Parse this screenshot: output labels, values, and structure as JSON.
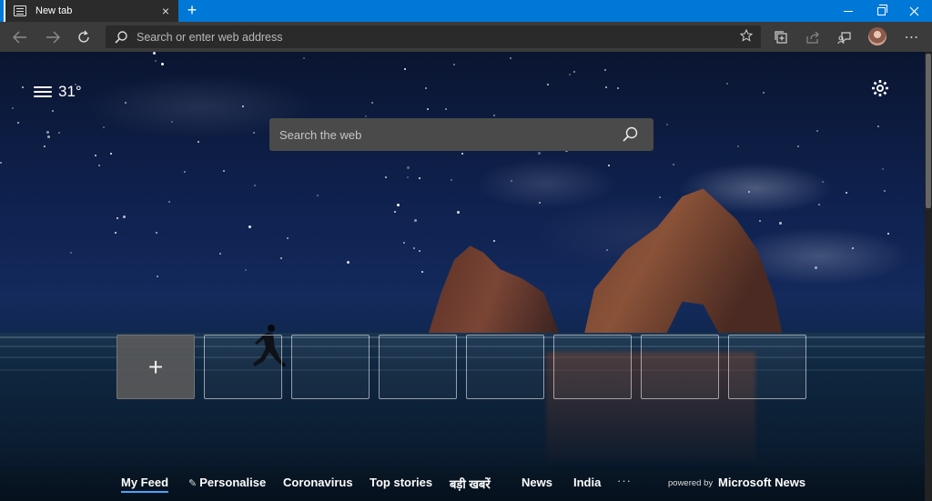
{
  "browser": {
    "tab_title": "New tab",
    "tab_icon": "new-tab-page-icon",
    "new_tab_symbol": "+",
    "close_symbol": "×",
    "accent_color": "#0078d7"
  },
  "toolbar": {
    "address_placeholder": "Search or enter web address",
    "icons": [
      "back-icon",
      "forward-icon",
      "refresh-icon",
      "search-icon",
      "favorite-star-icon",
      "collections-icon",
      "share-icon",
      "feedback-icon",
      "profile-avatar",
      "more-icon"
    ],
    "more_symbol": "⋯"
  },
  "page": {
    "weather_temp": "31°",
    "weather_icon": "haze-icon",
    "settings_icon": "gear-icon",
    "search_placeholder": "Search the web",
    "add_tile_symbol": "+",
    "tile_count": 7
  },
  "feed": {
    "items": [
      "My Feed",
      "Personalise",
      "Coronavirus",
      "Top stories",
      "बड़ी खबरें",
      "News",
      "India"
    ],
    "active": "My Feed",
    "more_symbol": "···",
    "powered_by": "powered by",
    "brand": "Microsoft News",
    "active_color": "#4aa3ff"
  }
}
